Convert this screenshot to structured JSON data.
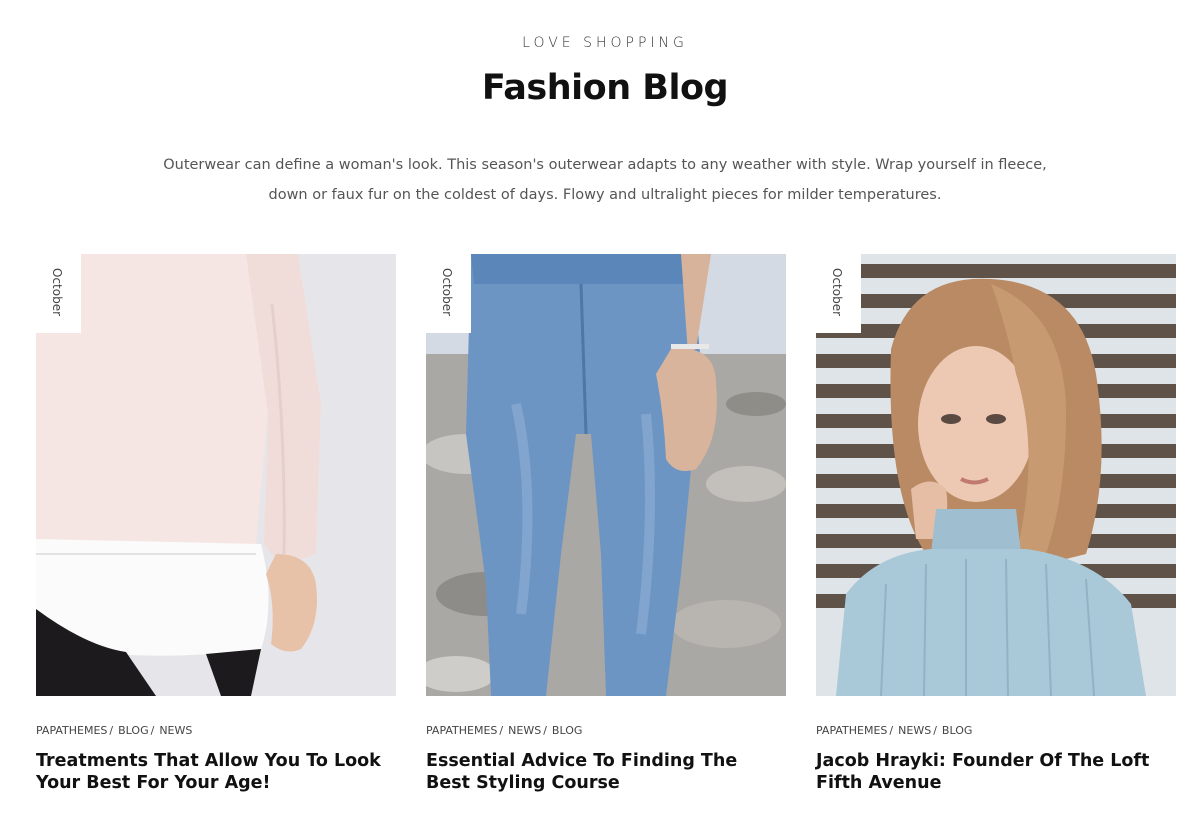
{
  "header": {
    "eyebrow": "LOVE SHOPPING",
    "title": "Fashion Blog",
    "intro_line1": "Outerwear can define a woman's look. This season's outerwear adapts to any weather with style. Wrap yourself in fleece,",
    "intro_line2": "down or faux fur on the coldest of days. Flowy and ultralight pieces for milder temperatures."
  },
  "posts": [
    {
      "date": "October",
      "categories": [
        "PAPATHEMES",
        "BLOG",
        "NEWS"
      ],
      "title": "Treatments That Allow You To Look Your Best For Your Age!",
      "image": "woman-pink-sweater-photo"
    },
    {
      "date": "October",
      "categories": [
        "PAPATHEMES",
        "NEWS",
        "BLOG"
      ],
      "title": "Essential Advice To Finding The Best Styling Course",
      "image": "woman-blue-jeans-photo"
    },
    {
      "date": "October",
      "categories": [
        "PAPATHEMES",
        "NEWS",
        "BLOG"
      ],
      "title": "Jacob Hrayki: Founder Of The Loft Fifth Avenue",
      "image": "woman-blue-turtleneck-photo"
    }
  ],
  "colors": {
    "text": "#111111",
    "muted": "#555555",
    "background": "#ffffff"
  }
}
